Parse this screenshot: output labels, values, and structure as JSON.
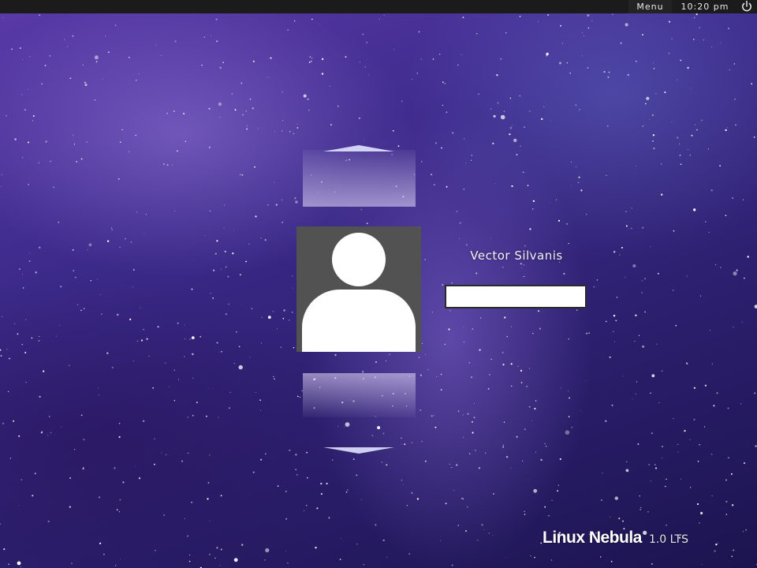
{
  "topbar": {
    "menu_label": "Menu",
    "clock": "10:20 pm",
    "power_icon": "power-icon"
  },
  "login": {
    "user_name": "Vector Silvanis",
    "password_value": "",
    "avatar_icon": "user-silhouette-icon",
    "prev_user_icon": "chevron-up-icon",
    "next_user_icon": "chevron-down-icon"
  },
  "branding": {
    "name": "Linux Nebula",
    "version": "1.0 LTS"
  },
  "colors": {
    "topbar_bg": "#1b1b1b",
    "avatar_bg": "#525252",
    "background_purple": "#3c2a8a"
  }
}
